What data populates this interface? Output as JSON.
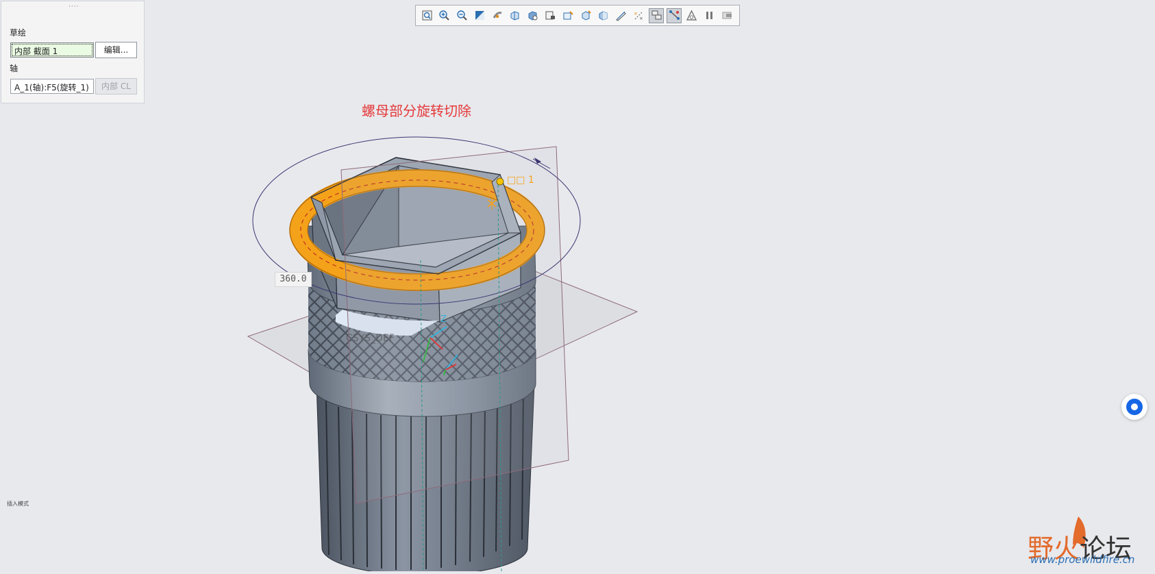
{
  "panel": {
    "grip": "····",
    "sketch_label": "草绘",
    "sketch_value": "内部 截面 1",
    "edit_button": "编辑...",
    "axis_label": "轴",
    "axis_value": "A_1(轴):F5(旋转_1)",
    "internal_cl_button": "内部 CL"
  },
  "toolbar": {
    "icons": [
      "refit-icon",
      "zoom-in-icon",
      "zoom-out-icon",
      "repaint-icon",
      "spin-center-icon",
      "saved-orientations-icon",
      "display-style-icon",
      "view-manager-icon",
      "sketch-view-icon",
      "annotation-display-icon",
      "section-icon",
      "appearance-icon",
      "datum-display-icon",
      "datum-plane-on-icon",
      "datum-axis-on-icon",
      "preview-icon",
      "pause-icon",
      "finish-icon"
    ],
    "active": [
      13,
      14
    ]
  },
  "viewport": {
    "caption": "螺母部分旋转切除",
    "angle_dimension": "360.0",
    "section_label": "□□ 1",
    "csys_label": "CSYS_DEF",
    "z_axis_label": "Z"
  },
  "statusbar": {
    "text": "插入模式"
  },
  "watermark": {
    "title_part1": "野火",
    "title_part2": "论坛",
    "url": "www.proewildfire.cn"
  },
  "colors": {
    "highlight": "#f5a21b",
    "model": "#8a95a3",
    "caption": "#e5393a"
  }
}
